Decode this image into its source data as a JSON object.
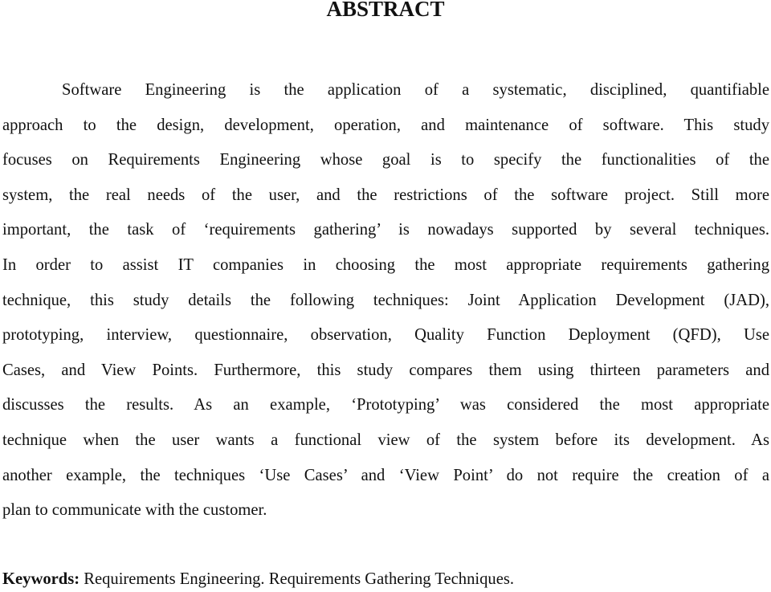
{
  "title": "ABSTRACT",
  "paragraph_lines": [
    "Software Engineering is the application of a systematic, disciplined, quantifiable",
    "approach to the design, development, operation, and maintenance of software. This study",
    "focuses on Requirements Engineering whose goal is to specify the functionalities of the",
    "system, the real needs of the user, and the restrictions of the software project. Still more",
    "important, the task of ‘requirements gathering’ is nowadays supported by several techniques.",
    "In order to assist IT companies in choosing the most appropriate requirements gathering",
    "technique, this study details the following techniques: Joint Application Development (JAD),",
    "prototyping, interview, questionnaire, observation, Quality Function Deployment (QFD), Use",
    "Cases, and View Points. Furthermore, this study compares them using thirteen parameters and",
    "discusses the results. As an example, ‘Prototyping’ was considered the most appropriate",
    "technique when the user wants a functional view of the system before its development. As",
    "another example, the techniques ‘Use Cases’ and ‘View Point’ do not require the creation of a",
    "plan to communicate with the customer."
  ],
  "keywords": {
    "label": "Keywords:",
    "text": " Requirements Engineering. Requirements Gathering Techniques."
  }
}
